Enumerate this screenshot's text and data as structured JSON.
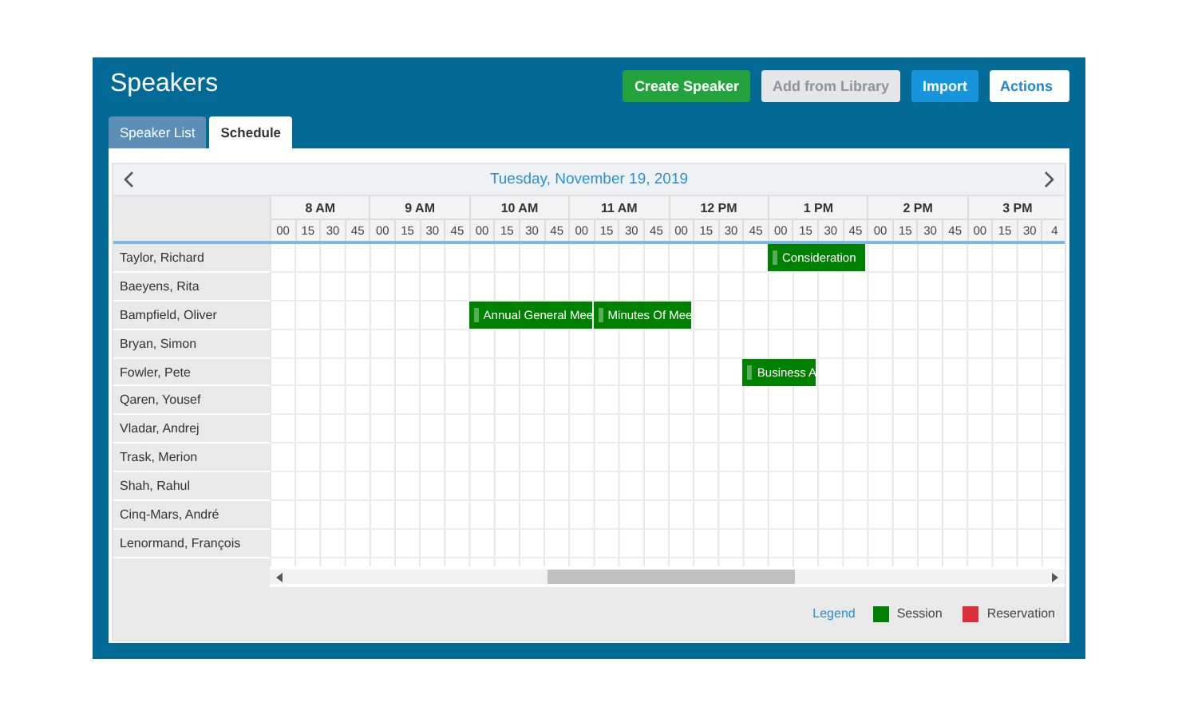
{
  "header": {
    "title": "Speakers"
  },
  "buttons": [
    {
      "label": "Create Speaker",
      "kind": "primary",
      "disabled": false
    },
    {
      "label": "Add from Library",
      "kind": "secondary",
      "disabled": true
    },
    {
      "label": "Import",
      "kind": "info",
      "disabled": false
    },
    {
      "label": "Actions",
      "kind": "menu",
      "disabled": false
    }
  ],
  "tabs": [
    {
      "label": "Speaker List",
      "selected": false
    },
    {
      "label": "Schedule",
      "selected": true
    }
  ],
  "scheduler": {
    "date": "Tuesday, November 19, 2019",
    "hours": [
      {
        "label": "8 AM",
        "minutes": [
          "00",
          "15",
          "30",
          "45"
        ]
      },
      {
        "label": "9 AM",
        "minutes": [
          "00",
          "15",
          "30",
          "45"
        ]
      },
      {
        "label": "10 AM",
        "minutes": [
          "00",
          "15",
          "30",
          "45"
        ]
      },
      {
        "label": "11 AM",
        "minutes": [
          "00",
          "15",
          "30",
          "45"
        ]
      },
      {
        "label": "12 PM",
        "minutes": [
          "00",
          "15",
          "30",
          "45"
        ]
      },
      {
        "label": "1 PM",
        "minutes": [
          "00",
          "15",
          "30",
          "45"
        ]
      },
      {
        "label": "2 PM",
        "minutes": [
          "00",
          "15",
          "30",
          "45"
        ]
      },
      {
        "label": "3 PM",
        "minutes": [
          "00",
          "15",
          "30",
          "4"
        ]
      }
    ],
    "speakers": [
      {
        "name": "Taylor, Richard",
        "events": [
          {
            "title": "Consideration",
            "kind": "session"
          }
        ]
      },
      {
        "name": "Baeyens, Rita"
      },
      {
        "name": "Bampfield, Oliver",
        "events": [
          {
            "title": "Annual General Mee",
            "kind": "session"
          },
          {
            "title": "Minutes Of Mee",
            "kind": "session"
          }
        ]
      },
      {
        "name": "Bryan, Simon"
      },
      {
        "name": "Fowler, Pete",
        "events": [
          {
            "title": "Business A",
            "kind": "session"
          }
        ]
      },
      {
        "name": "Qaren, Yousef"
      },
      {
        "name": "Vladar, Andrej"
      },
      {
        "name": "Trask, Merion"
      },
      {
        "name": "Shah, Rahul"
      },
      {
        "name": "Cinq-Mars, André"
      },
      {
        "name": "Lenormand, François"
      }
    ],
    "legend": {
      "title": "Legend",
      "items": [
        {
          "label": "Session",
          "kind": "session",
          "color": "#008000"
        },
        {
          "label": "Reservation",
          "kind": "reservation",
          "color": "#d9303a"
        }
      ]
    }
  }
}
